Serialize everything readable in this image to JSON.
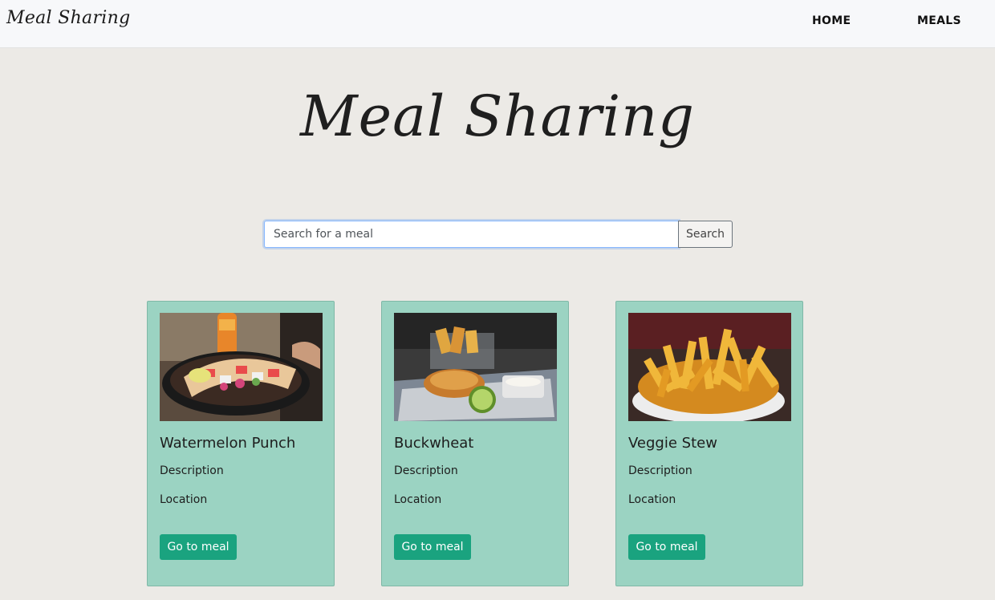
{
  "navbar": {
    "brand": "Meal Sharing",
    "links": [
      {
        "label": "HOME"
      },
      {
        "label": "MEALS"
      }
    ]
  },
  "hero": {
    "title": "Meal Sharing"
  },
  "search": {
    "placeholder": "Search for a meal",
    "value": "",
    "button_label": "Search"
  },
  "meals": [
    {
      "title": "Watermelon Punch",
      "description": "Description",
      "location": "Location",
      "button_label": "Go to meal",
      "image_icon": "taco-basket-photo"
    },
    {
      "title": "Buckwheat",
      "description": "Description",
      "location": "Location",
      "button_label": "Go to meal",
      "image_icon": "fish-and-chips-photo"
    },
    {
      "title": "Veggie Stew",
      "description": "Description",
      "location": "Location",
      "button_label": "Go to meal",
      "image_icon": "french-fries-photo"
    }
  ],
  "colors": {
    "page_background": "#eceae6",
    "card_background": "#9bd3c2",
    "button_background": "#1aa37f",
    "navbar_background": "#f7f8fa"
  }
}
